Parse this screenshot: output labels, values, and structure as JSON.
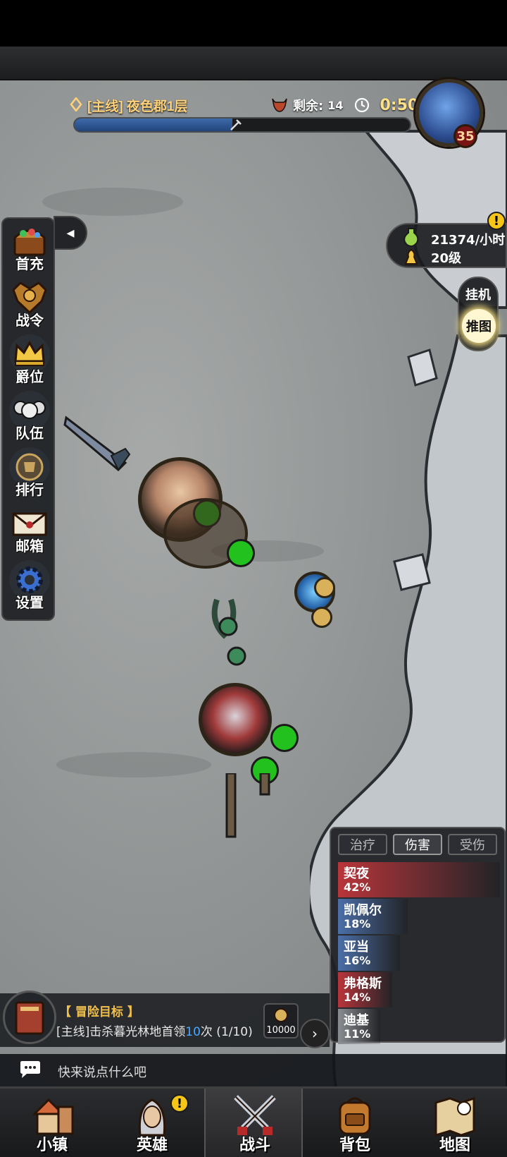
{
  "stage": {
    "label": "[主线] 夜色郡1层",
    "remaining_label": "剩余:",
    "remaining_count": "14",
    "timer": "0:50",
    "progress": 0.47,
    "boss_level": "35"
  },
  "left_menu": {
    "items": [
      {
        "label": "首充",
        "icon": "treasure-chest-icon"
      },
      {
        "label": "战令",
        "icon": "battle-pass-icon"
      },
      {
        "label": "爵位",
        "icon": "crown-icon"
      },
      {
        "label": "队伍",
        "icon": "team-icon"
      },
      {
        "label": "排行",
        "icon": "ranking-icon"
      },
      {
        "label": "邮箱",
        "icon": "mail-icon"
      },
      {
        "label": "设置",
        "icon": "gear-icon"
      }
    ],
    "collapse_glyph": "◂"
  },
  "income": {
    "rate": "21374/小时",
    "level": "20级",
    "alert": "!"
  },
  "mode": {
    "idle": "挂机",
    "push": "推图"
  },
  "damage_panel": {
    "tabs": [
      {
        "label": "治疗",
        "active": false
      },
      {
        "label": "伤害",
        "active": true
      },
      {
        "label": "受伤",
        "active": false
      }
    ],
    "rows": [
      {
        "name": "契夜",
        "pct": "42%",
        "value": 0.42,
        "color": "#b8353a"
      },
      {
        "name": "凯佩尔",
        "pct": "18%",
        "value": 0.18,
        "color": "#4b6fa8"
      },
      {
        "name": "亚当",
        "pct": "16%",
        "value": 0.16,
        "color": "#4b6fa8"
      },
      {
        "name": "弗格斯",
        "pct": "14%",
        "value": 0.14,
        "color": "#b8353a"
      },
      {
        "name": "迪基",
        "pct": "11%",
        "value": 0.11,
        "color": "#8a8d92"
      }
    ]
  },
  "quest": {
    "title": "【 冒险目标 】",
    "desc_prefix": "[主线]击杀暮光林地首领",
    "desc_highlight": "10",
    "desc_suffix": "次 (1/10)",
    "reward_value": "10000",
    "expand_glyph": "›"
  },
  "chat": {
    "placeholder": "快来说点什么吧"
  },
  "nav": {
    "items": [
      {
        "label": "小镇",
        "icon": "town-icon",
        "active": false
      },
      {
        "label": "英雄",
        "icon": "hero-icon",
        "active": false,
        "badge": "!"
      },
      {
        "label": "战斗",
        "icon": "battle-icon",
        "active": true
      },
      {
        "label": "背包",
        "icon": "backpack-icon",
        "active": false
      },
      {
        "label": "地图",
        "icon": "map-icon",
        "active": false
      }
    ]
  }
}
